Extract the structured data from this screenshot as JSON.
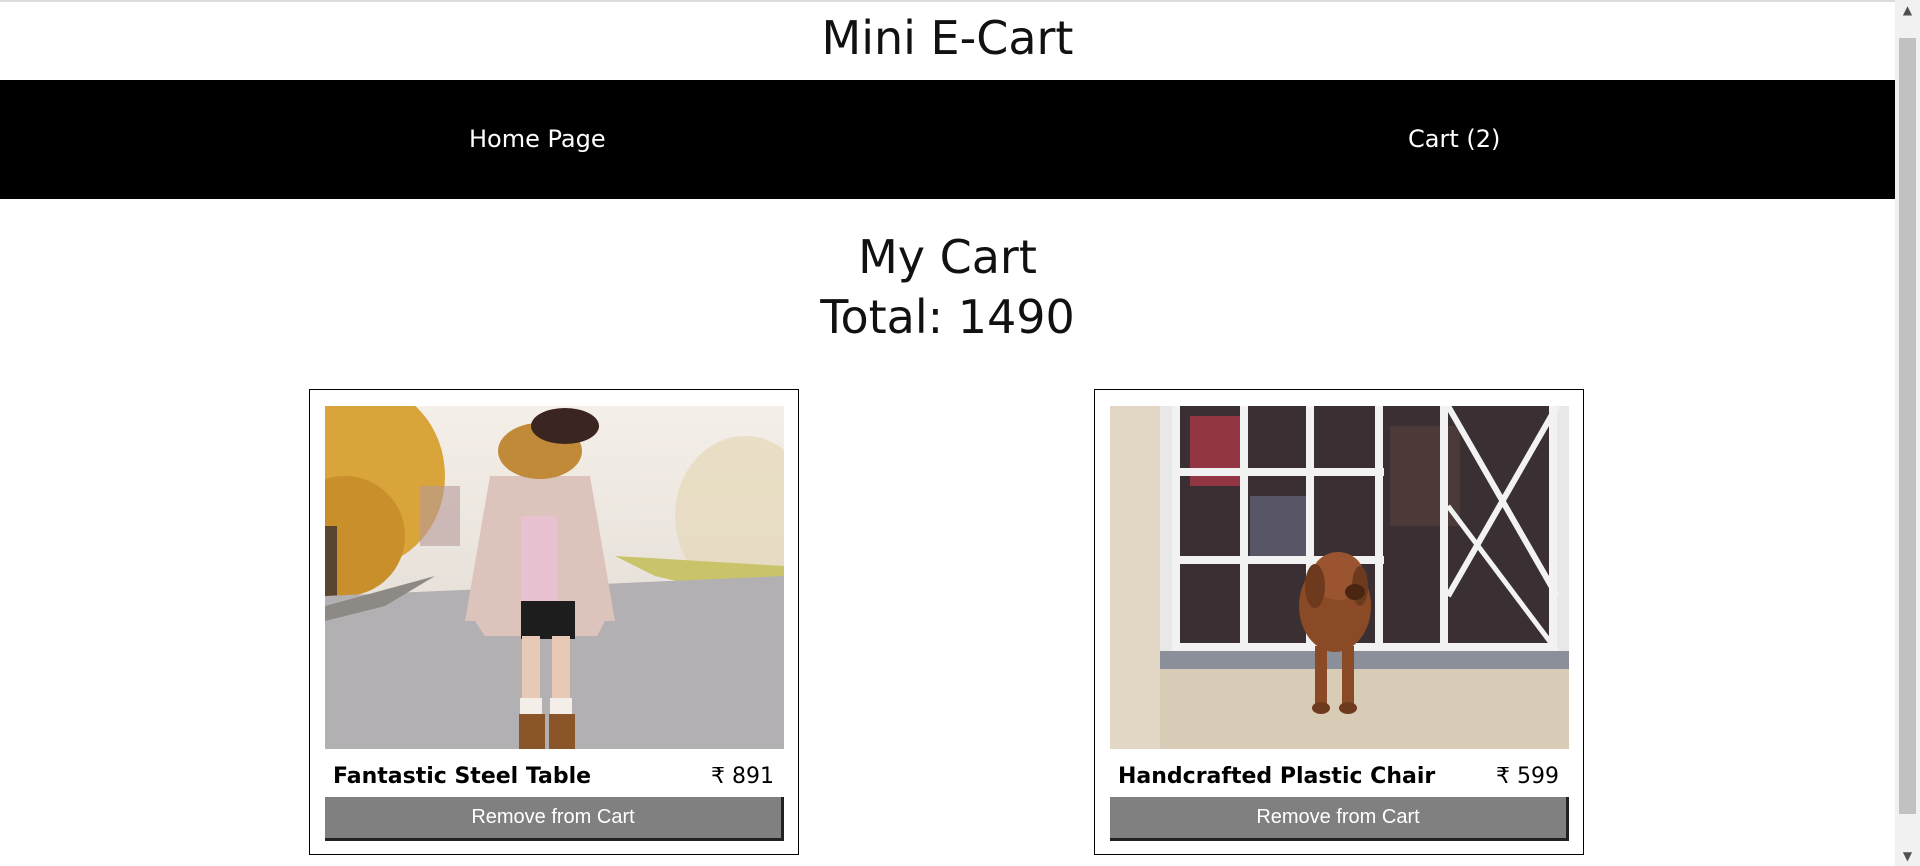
{
  "header": {
    "title": "Mini E-Cart"
  },
  "nav": {
    "home_label": "Home Page",
    "cart_label": "Cart (2)"
  },
  "cart": {
    "heading": "My Cart",
    "total_label": "Total: 1490",
    "items": [
      {
        "name": "Fantastic Steel Table",
        "price": "₹ 891",
        "button_label": "Remove from Cart",
        "image": "woman-in-coat-and-scarf-on-autumn-road"
      },
      {
        "name": "Handcrafted Plastic Chair",
        "price": "₹ 599",
        "button_label": "Remove from Cart",
        "image": "dachshund-dog-at-barred-window"
      }
    ]
  },
  "colors": {
    "navbar_bg": "#000000",
    "button_bg": "#808080",
    "text": "#111111"
  }
}
